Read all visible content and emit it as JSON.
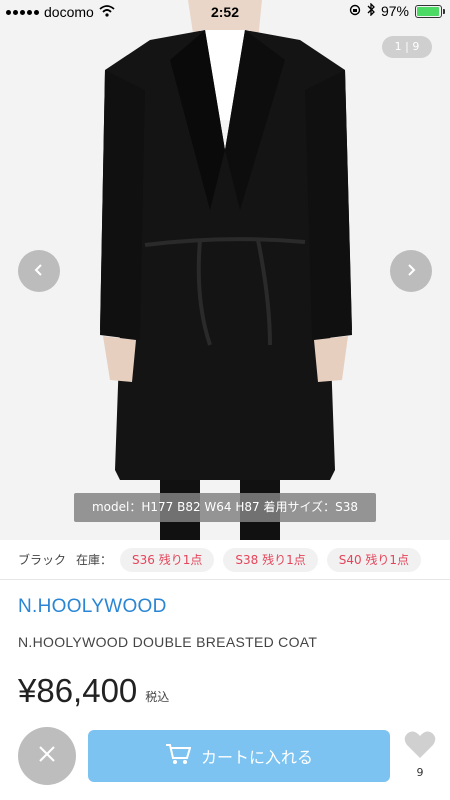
{
  "status_bar": {
    "carrier": "docomo",
    "time": "2:52",
    "battery": "97%",
    "battery_level": 0.97
  },
  "gallery": {
    "counter": "1 | 9",
    "model_caption": "model：H177 B82 W64 H87 着用サイズ：S38"
  },
  "variant": {
    "color": "ブラック",
    "stock_label": "在庫：",
    "sizes": [
      "S36 残り1点",
      "S38 残り1点",
      "S40 残り1点"
    ]
  },
  "product": {
    "brand": "N.HOOLYWOOD",
    "name": "N.HOOLYWOOD DOUBLE BREASTED COAT",
    "price": "¥86,400",
    "tax_note": "税込"
  },
  "actions": {
    "cart_label": "カートに入れる",
    "like_count": "9"
  },
  "colors": {
    "brand": "#2a86d4",
    "cart_button": "#7dc3f2",
    "size_chip_text": "#e4455b",
    "battery": "#4cd964"
  }
}
